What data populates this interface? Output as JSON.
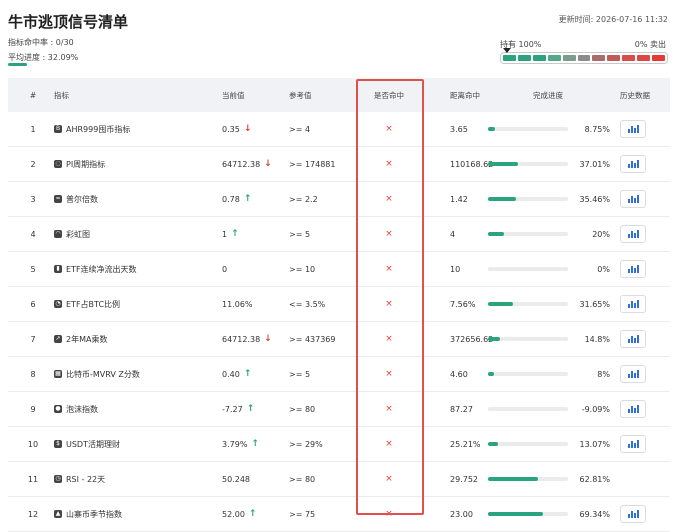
{
  "header": {
    "title": "牛市逃顶信号清单",
    "updated": "更新时间: 2026-07-16 11:32",
    "hit_rate": "指标命中率 : 0/30",
    "avg_progress": "平均进度 : 32.09%",
    "avg_progress_fraction": 0.3209,
    "hold_label": "持有 100%",
    "sell_label": "0% 卖出",
    "meter_colors": [
      "#2aa380",
      "#2aa380",
      "#2aa380",
      "#57a88a",
      "#7c9d8c",
      "#8c8c8c",
      "#a86c6c",
      "#c25a5a",
      "#d84c4c",
      "#e04545",
      "#e53935"
    ]
  },
  "columns": {
    "num": "#",
    "name": "指标",
    "current": "当前值",
    "ref": "参考值",
    "hit": "是否命中",
    "dist": "距离命中",
    "progress": "完成进度",
    "history": "历史数据"
  },
  "colors": {
    "accent": "#2aa380",
    "down": "#e53935",
    "highlight_border": "#e0504f"
  },
  "rows": [
    {
      "num": "1",
      "icon": "ahr-icon",
      "name": "AHR999囤币指标",
      "current": "0.35",
      "trend": "down",
      "ref": ">= 4",
      "hit": "×",
      "dist": "3.65",
      "progress": "8.75%",
      "fraction": 0.0875,
      "history": true
    },
    {
      "num": "2",
      "icon": "pi-cycle-icon",
      "name": "PI周期指标",
      "current": "64712.38",
      "trend": "down",
      "ref": ">= 174881",
      "hit": "×",
      "dist": "110168.62",
      "progress": "37.01%",
      "fraction": 0.3701,
      "history": true
    },
    {
      "num": "3",
      "icon": "puell-icon",
      "name": "普尔倍数",
      "current": "0.78",
      "trend": "up",
      "ref": ">= 2.2",
      "hit": "×",
      "dist": "1.42",
      "progress": "35.46%",
      "fraction": 0.3546,
      "history": true
    },
    {
      "num": "4",
      "icon": "rainbow-icon",
      "name": "彩虹图",
      "current": "1",
      "trend": "up",
      "ref": ">= 5",
      "hit": "×",
      "dist": "4",
      "progress": "20%",
      "fraction": 0.2,
      "history": true
    },
    {
      "num": "5",
      "icon": "etf-outflow-icon",
      "name": "ETF连续净流出天数",
      "current": "0",
      "trend": "",
      "ref": ">= 10",
      "hit": "×",
      "dist": "10",
      "progress": "0%",
      "fraction": 0,
      "history": true
    },
    {
      "num": "6",
      "icon": "pie-chart-icon",
      "name": "ETF占BTC比例",
      "current": "11.06%",
      "trend": "",
      "ref": "<= 3.5%",
      "hit": "×",
      "dist": "7.56%",
      "progress": "31.65%",
      "fraction": 0.3165,
      "history": true
    },
    {
      "num": "7",
      "icon": "line-chart-icon",
      "name": "2年MA乘数",
      "current": "64712.38",
      "trend": "down",
      "ref": ">= 437369",
      "hit": "×",
      "dist": "372656.62",
      "progress": "14.8%",
      "fraction": 0.148,
      "history": true
    },
    {
      "num": "8",
      "icon": "calendar-icon",
      "name": "比特币-MVRV Z分数",
      "current": "0.40",
      "trend": "up",
      "ref": ">= 5",
      "hit": "×",
      "dist": "4.60",
      "progress": "8%",
      "fraction": 0.08,
      "history": true
    },
    {
      "num": "9",
      "icon": "bubble-icon",
      "name": "泡沫指数",
      "current": "-7.27",
      "trend": "up",
      "ref": ">= 80",
      "hit": "×",
      "dist": "87.27",
      "progress": "-9.09%",
      "fraction": 0,
      "history": true
    },
    {
      "num": "10",
      "icon": "dollar-icon",
      "name": "USDT活期理财",
      "current": "3.79%",
      "trend": "up",
      "ref": ">= 29%",
      "hit": "×",
      "dist": "25.21%",
      "progress": "13.07%",
      "fraction": 0.1307,
      "history": true
    },
    {
      "num": "11",
      "icon": "clock-icon",
      "name": "RSI - 22天",
      "current": "50.248",
      "trend": "",
      "ref": ">= 80",
      "hit": "×",
      "dist": "29.752",
      "progress": "62.81%",
      "fraction": 0.6281,
      "history": false
    },
    {
      "num": "12",
      "icon": "fire-icon",
      "name": "山寨币季节指数",
      "current": "52.00",
      "trend": "up",
      "ref": ">= 75",
      "hit": "×",
      "dist": "23.00",
      "progress": "69.34%",
      "fraction": 0.6934,
      "history": true
    }
  ]
}
